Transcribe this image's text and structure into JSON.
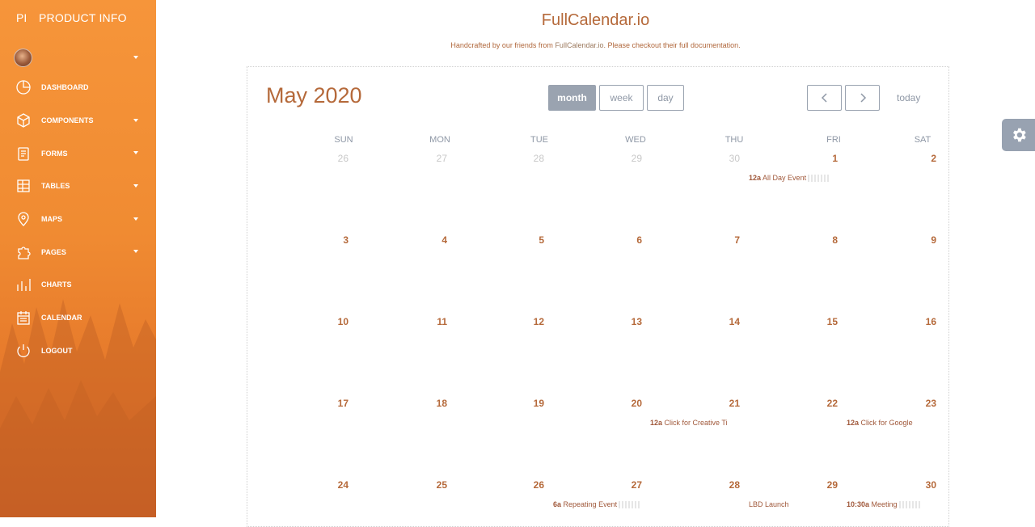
{
  "sidebar": {
    "brand_mini": "PI",
    "brand_full": "PRODUCT INFO",
    "items": [
      {
        "label": "DASHBOARD",
        "icon": "dashboard-icon",
        "has_caret": false
      },
      {
        "label": "COMPONENTS",
        "icon": "cube-icon",
        "has_caret": true
      },
      {
        "label": "FORMS",
        "icon": "clipboard-icon",
        "has_caret": true
      },
      {
        "label": "TABLES",
        "icon": "table-icon",
        "has_caret": true
      },
      {
        "label": "MAPS",
        "icon": "map-pin-icon",
        "has_caret": true
      },
      {
        "label": "PAGES",
        "icon": "puzzle-icon",
        "has_caret": true
      },
      {
        "label": "CHARTS",
        "icon": "bar-chart-icon",
        "has_caret": false
      },
      {
        "label": "CALENDAR",
        "icon": "calendar-icon",
        "has_caret": false
      },
      {
        "label": "LOGOUT",
        "icon": "power-icon",
        "has_caret": false
      }
    ]
  },
  "header": {
    "title": "FullCalendar.io",
    "subtitle_prefix": "Handcrafted by our friends from ",
    "subtitle_link": "FullCalendar.io",
    "subtitle_middle": ". Please checkout their ",
    "subtitle_doc": "full documentation",
    "subtitle_suffix": "."
  },
  "calendar": {
    "title": "May 2020",
    "views": [
      "month",
      "week",
      "day"
    ],
    "active_view": "month",
    "today_label": "today",
    "prev_icon": "chevron-left-icon",
    "next_icon": "chevron-right-icon",
    "days_of_week": [
      "SUN",
      "MON",
      "TUE",
      "WED",
      "THU",
      "FRI",
      "SAT"
    ],
    "weeks": [
      [
        {
          "n": "26",
          "other": true
        },
        {
          "n": "27",
          "other": true
        },
        {
          "n": "28",
          "other": true
        },
        {
          "n": "29",
          "other": true
        },
        {
          "n": "30",
          "other": true
        },
        {
          "n": "1",
          "other": false
        },
        {
          "n": "2",
          "other": false
        }
      ],
      [
        {
          "n": "3"
        },
        {
          "n": "4"
        },
        {
          "n": "5"
        },
        {
          "n": "6"
        },
        {
          "n": "7"
        },
        {
          "n": "8"
        },
        {
          "n": "9"
        }
      ],
      [
        {
          "n": "10"
        },
        {
          "n": "11"
        },
        {
          "n": "12"
        },
        {
          "n": "13"
        },
        {
          "n": "14"
        },
        {
          "n": "15"
        },
        {
          "n": "16"
        }
      ],
      [
        {
          "n": "17"
        },
        {
          "n": "18"
        },
        {
          "n": "19"
        },
        {
          "n": "20"
        },
        {
          "n": "21"
        },
        {
          "n": "22"
        },
        {
          "n": "23"
        }
      ],
      [
        {
          "n": "24"
        },
        {
          "n": "25"
        },
        {
          "n": "26"
        },
        {
          "n": "27"
        },
        {
          "n": "28"
        },
        {
          "n": "29"
        },
        {
          "n": "30"
        }
      ]
    ],
    "events": [
      {
        "week": 0,
        "day": 4,
        "time": "12a",
        "title": "All Day Event",
        "fade": true
      },
      {
        "week": 3,
        "day": 3,
        "time": "12a",
        "title": "Click for Creative Ti",
        "fade": false
      },
      {
        "week": 3,
        "day": 5,
        "time": "12a",
        "title": "Click for Google",
        "fade": false
      },
      {
        "week": 4,
        "day": 2,
        "time": "6a",
        "title": "Repeating Event",
        "fade": true
      },
      {
        "week": 4,
        "day": 4,
        "time": "",
        "title": "LBD Launch",
        "fade": false
      },
      {
        "week": 4,
        "day": 5,
        "time": "10:30a",
        "title": "Meeting",
        "fade": true
      }
    ]
  },
  "settings_icon": "gear-icon",
  "colors": {
    "sidebar_top": "#f6953a",
    "sidebar_bottom": "#d9692a",
    "accent_text": "#b5693a",
    "button_gray": "#9aa3b0"
  }
}
